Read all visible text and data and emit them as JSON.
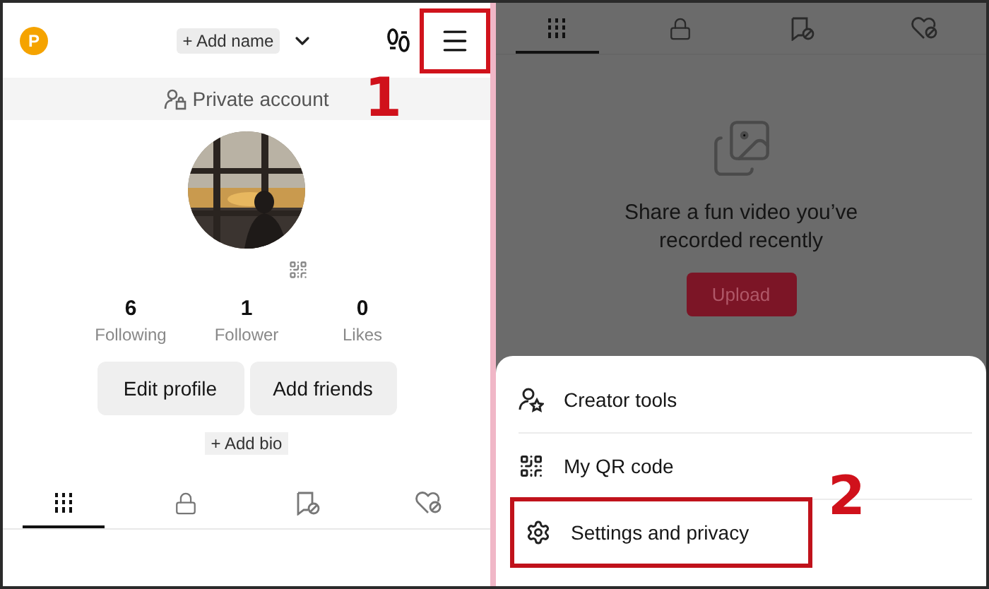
{
  "left_panel": {
    "header": {
      "avatar_letter": "P",
      "add_name": "+ Add name",
      "menu_highlighted": true
    },
    "private_account": "Private account",
    "stats": [
      {
        "value": "6",
        "label": "Following"
      },
      {
        "value": "1",
        "label": "Follower"
      },
      {
        "value": "0",
        "label": "Likes"
      }
    ],
    "buttons": [
      "Edit profile",
      "Add friends"
    ],
    "add_bio": "+ Add bio",
    "tabs": [
      {
        "kind": "grid",
        "selected": true
      },
      {
        "kind": "lock",
        "selected": false
      },
      {
        "kind": "tag",
        "selected": false
      },
      {
        "kind": "heart",
        "selected": false
      }
    ]
  },
  "right_panel": {
    "tabs": [
      {
        "kind": "grid",
        "selected": true
      },
      {
        "kind": "lock",
        "selected": false
      },
      {
        "kind": "tag",
        "selected": false
      },
      {
        "kind": "heart",
        "selected": false
      }
    ],
    "empty_state": {
      "message": "Share a fun video you’ve recorded recently",
      "upload": "Upload"
    },
    "menu": [
      {
        "kind": "creator",
        "label": "Creator tools",
        "highlighted": false
      },
      {
        "kind": "qr",
        "label": "My QR code",
        "highlighted": false
      },
      {
        "kind": "settings",
        "label": "Settings and privacy",
        "highlighted": true
      }
    ]
  },
  "annotations": [
    {
      "label": "1"
    },
    {
      "label": "2"
    }
  ]
}
